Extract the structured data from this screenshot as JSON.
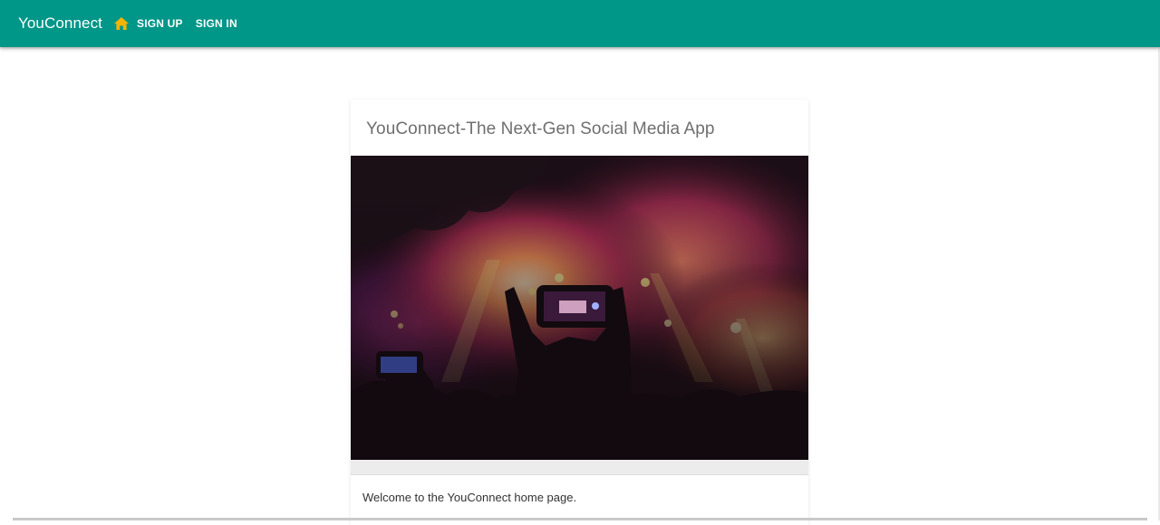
{
  "app": {
    "brand": "YouConnect",
    "home_icon": "home-icon",
    "nav": {
      "signup": "SIGN UP",
      "signin": "SIGN IN"
    },
    "colors": {
      "appbar": "#009688",
      "home_icon": "#f5b301"
    }
  },
  "card": {
    "title": "YouConnect-The Next-Gen Social Media App",
    "media": "concert-crowd-phone-photo",
    "body": "Welcome to the YouConnect home page."
  }
}
